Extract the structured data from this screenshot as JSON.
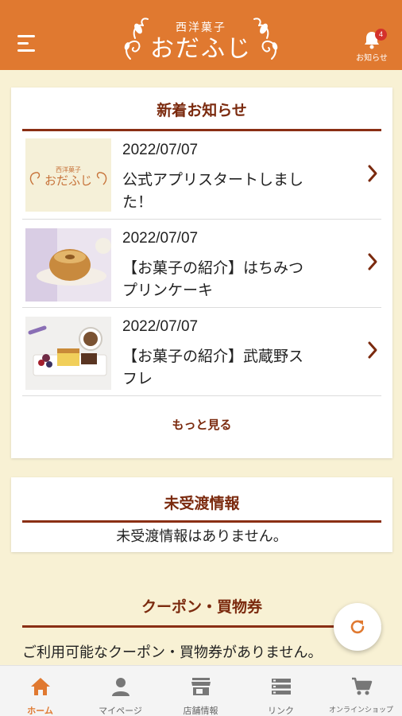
{
  "header": {
    "logo_small": "西洋菓子",
    "logo_main": "おだふじ",
    "notification_label": "お知らせ",
    "notification_count": "4"
  },
  "news": {
    "title": "新着お知らせ",
    "items": [
      {
        "date": "2022/07/07",
        "text": "公式アプリスタートしました！",
        "thumb": "logo-thumbnail"
      },
      {
        "date": "2022/07/07",
        "text": "【お菓子の紹介】はちみつプリンケーキ",
        "thumb": "honey-pudding-cake-photo"
      },
      {
        "date": "2022/07/07",
        "text": "【お菓子の紹介】武蔵野スフレ",
        "thumb": "musashino-souffle-photo"
      }
    ],
    "more_label": "もっと見る"
  },
  "undelivered": {
    "title": "未受渡情報",
    "message": "未受渡情報はありません。"
  },
  "coupon": {
    "title": "クーポン・買物券",
    "message": "ご利用可能なクーポン・買物券がありません。"
  },
  "tabbar": {
    "items": [
      {
        "label": "ホーム",
        "icon": "home-icon",
        "active": true
      },
      {
        "label": "マイページ",
        "icon": "person-icon",
        "active": false
      },
      {
        "label": "店舗情報",
        "icon": "store-icon",
        "active": false
      },
      {
        "label": "リンク",
        "icon": "list-icon",
        "active": false
      },
      {
        "label": "オンラインショップ",
        "icon": "cart-icon",
        "active": false
      }
    ]
  },
  "colors": {
    "header": "#e07930",
    "background": "#f8f1d4",
    "accent_dark": "#7b2a0e",
    "badge": "#d4322c"
  }
}
